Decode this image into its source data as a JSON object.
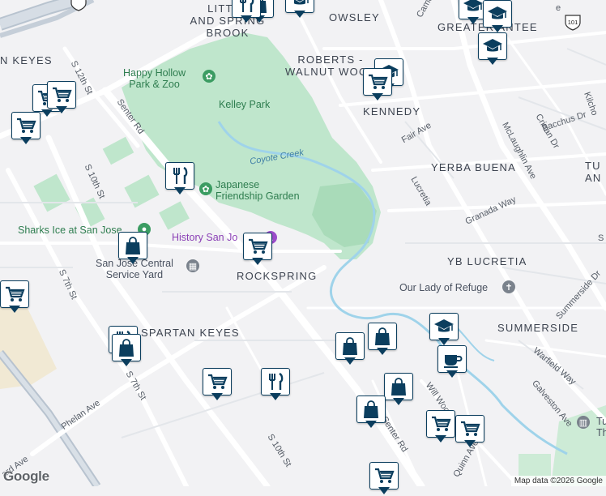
{
  "map": {
    "attribution": "Map data ©2026 Google",
    "logo": "Google",
    "neighborhoods": [
      {
        "id": "little-spring-brook",
        "text": "LITTLE\nAND SPRING\nBROOK"
      },
      {
        "id": "owsley",
        "text": "OWSLEY"
      },
      {
        "id": "greater-ante",
        "text": "GREATER ANTEE"
      },
      {
        "id": "roberts-walnut",
        "text": "ROBERTS -\nWALNUT WOODS"
      },
      {
        "id": "kennedy",
        "text": "KENNEDY"
      },
      {
        "id": "keyes",
        "text": "N KEYES"
      },
      {
        "id": "yerba-buena",
        "text": "YERBA BUENA"
      },
      {
        "id": "yb-lucretia",
        "text": "YB LUCRETIA"
      },
      {
        "id": "rockspring",
        "text": "ROCKSPRING"
      },
      {
        "id": "spartan-keyes",
        "text": "SPARTAN KEYES"
      },
      {
        "id": "summerside",
        "text": "SUMMERSIDE"
      },
      {
        "id": "tu-an",
        "text": "TU\nAN"
      }
    ],
    "places": [
      {
        "id": "happy-hollow",
        "text": "Happy Hollow\nPark & Zoo",
        "kind": "park"
      },
      {
        "id": "kelley-park",
        "text": "Kelley Park",
        "kind": "park"
      },
      {
        "id": "japanese-garden",
        "text": "Japanese\nFriendship Garden",
        "kind": "park"
      },
      {
        "id": "sharks-ice",
        "text": "Sharks Ice at San Jose",
        "kind": "park"
      },
      {
        "id": "history-sj",
        "text": "History San Jo",
        "kind": "museum"
      },
      {
        "id": "service-yard",
        "text": "San Jose Central\nService Yard",
        "kind": "grey"
      },
      {
        "id": "lady-refuge",
        "text": "Our Lady of Refuge",
        "kind": "grey"
      },
      {
        "id": "tu-place",
        "text": "Tu\nTh",
        "kind": "grey"
      }
    ],
    "water": [
      {
        "id": "coyote-creek",
        "text": "Coyote Creek"
      }
    ],
    "streets": [
      {
        "id": "s12th",
        "text": "S 12th St"
      },
      {
        "id": "senter-top",
        "text": "Senter Rd"
      },
      {
        "id": "s10th-a",
        "text": "S 10th St"
      },
      {
        "id": "s7th-a",
        "text": "S 7th St"
      },
      {
        "id": "s7th-b",
        "text": "S 7th St"
      },
      {
        "id": "phelan",
        "text": "Phelan Ave"
      },
      {
        "id": "s10th-b",
        "text": "S 10th St"
      },
      {
        "id": "senter-bottom",
        "text": "Senter Rd"
      },
      {
        "id": "mclaughlin",
        "text": "McLaughlin Ave"
      },
      {
        "id": "lucretia",
        "text": "Lucretia"
      },
      {
        "id": "bacchus",
        "text": "Bacchus Dr"
      },
      {
        "id": "crinan",
        "text": "Crinan Dr"
      },
      {
        "id": "fair",
        "text": "Fair Ave"
      },
      {
        "id": "granada",
        "text": "Granada Way"
      },
      {
        "id": "summerside-dr",
        "text": "Summerside Dr"
      },
      {
        "id": "warfield",
        "text": "Warfield Way"
      },
      {
        "id": "galveston",
        "text": "Galveston Ave"
      },
      {
        "id": "quinn",
        "text": "Quinn Ave"
      },
      {
        "id": "will-wool",
        "text": "Will Wool"
      },
      {
        "id": "kilch",
        "text": "Kilcho"
      },
      {
        "id": "came",
        "text": "Came"
      },
      {
        "id": "ard",
        "text": "ard Ave"
      },
      {
        "id": "s-short",
        "text": "S"
      },
      {
        "id": "e-short",
        "text": "e"
      }
    ],
    "highway": "101",
    "markers": [
      {
        "id": "m1",
        "type": "shop"
      },
      {
        "id": "m2",
        "type": "school"
      },
      {
        "id": "m3",
        "type": "school"
      },
      {
        "id": "m4",
        "type": "cart"
      },
      {
        "id": "m5",
        "type": "cart"
      },
      {
        "id": "m6",
        "type": "cart"
      },
      {
        "id": "m7",
        "type": "school"
      },
      {
        "id": "m8",
        "type": "restaurant"
      },
      {
        "id": "m9",
        "type": "school"
      },
      {
        "id": "m10",
        "type": "restaurant"
      },
      {
        "id": "m11",
        "type": "school"
      },
      {
        "id": "m12",
        "type": "shop"
      },
      {
        "id": "m13",
        "type": "cart"
      },
      {
        "id": "m14",
        "type": "cart"
      },
      {
        "id": "m15",
        "type": "restaurant"
      },
      {
        "id": "m16",
        "type": "shop"
      },
      {
        "id": "m17",
        "type": "shop"
      },
      {
        "id": "m18",
        "type": "school"
      },
      {
        "id": "m19",
        "type": "cafe"
      },
      {
        "id": "m20",
        "type": "cart"
      },
      {
        "id": "m21",
        "type": "restaurant"
      },
      {
        "id": "m22",
        "type": "shop"
      },
      {
        "id": "m23",
        "type": "shop"
      },
      {
        "id": "m24",
        "type": "cart"
      },
      {
        "id": "m25",
        "type": "cart"
      },
      {
        "id": "m26",
        "type": "cart"
      },
      {
        "id": "m27",
        "type": "cart"
      },
      {
        "id": "m28",
        "type": "shop"
      }
    ],
    "colors": {
      "marker": "#0b3e5e",
      "park": "#bfe6cc",
      "water": "#9fd3ea",
      "road": "#ffffff",
      "background": "#f2f2f4"
    }
  }
}
